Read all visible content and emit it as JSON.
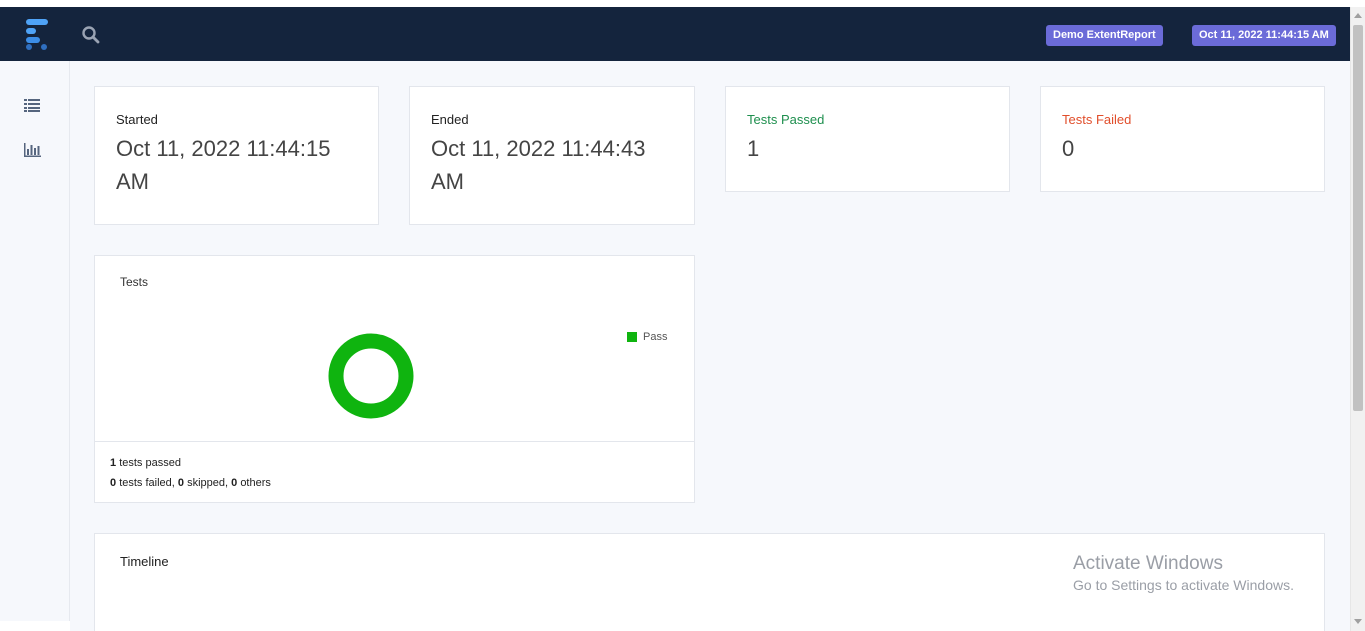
{
  "header": {
    "report_name": "Demo ExtentReport",
    "report_date": "Oct 11, 2022 11:44:15 AM",
    "logo_icon": "extent-logo-icon",
    "search_icon": "search-icon",
    "colors": {
      "navbar": "#14243d",
      "badge": "#6b6bd8",
      "logo": "#4fa3f7"
    }
  },
  "sidebar": {
    "items": [
      {
        "icon": "list-icon"
      },
      {
        "icon": "bar-chart-icon"
      }
    ]
  },
  "summary": {
    "started": {
      "label": "Started",
      "value": "Oct 11, 2022 11:44:15 AM"
    },
    "ended": {
      "label": "Ended",
      "value": "Oct 11, 2022 11:44:43 AM"
    },
    "passed": {
      "label": "Tests Passed",
      "value": "1",
      "color": "#1e8f4e"
    },
    "failed": {
      "label": "Tests Failed",
      "value": "0",
      "color": "#e14e2b"
    }
  },
  "tests_chart": {
    "title": "Tests",
    "legend_pass": "Pass",
    "passed_count": "1",
    "passed_text": "tests passed",
    "failed_count": "0",
    "failed_text": "tests failed,",
    "skipped_count": "0",
    "skipped_text": "skipped,",
    "others_count": "0",
    "others_text": "others"
  },
  "chart_data": {
    "type": "pie",
    "categories": [
      "Pass"
    ],
    "values": [
      1
    ],
    "colors": [
      "#0fb40f"
    ],
    "title": "Tests"
  },
  "timeline": {
    "title": "Timeline"
  },
  "watermark": {
    "title": "Activate Windows",
    "subtitle": "Go to Settings to activate Windows."
  }
}
